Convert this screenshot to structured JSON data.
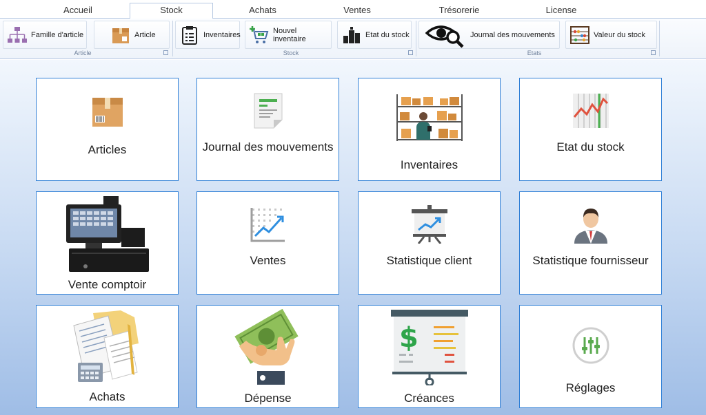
{
  "tabs": [
    {
      "label": "Accueil"
    },
    {
      "label": "Stock"
    },
    {
      "label": "Achats"
    },
    {
      "label": "Ventes"
    },
    {
      "label": "Trésorerie"
    },
    {
      "label": "License"
    }
  ],
  "active_tab": "Stock",
  "ribbon": {
    "buttons": [
      {
        "label": "Famille d'article",
        "icon": "hierarchy-icon"
      },
      {
        "label": "Article",
        "icon": "box-icon"
      },
      {
        "label": "Inventaires",
        "icon": "clipboard-icon"
      },
      {
        "label": "Nouvel inventaire",
        "icon": "cart-add-icon"
      },
      {
        "label": "Etat du stock",
        "icon": "stock-boxes-icon"
      },
      {
        "label": "Journal des mouvements",
        "icon": "eye-search-icon"
      },
      {
        "label": "Valeur du stock",
        "icon": "abacus-icon"
      }
    ],
    "groups": [
      "Article",
      "Stock",
      "Etats"
    ]
  },
  "tiles": [
    {
      "label": "Articles",
      "icon": "box-icon"
    },
    {
      "label": "Journal des mouvements",
      "icon": "document-icon"
    },
    {
      "label": "Inventaires",
      "icon": "warehouse-icon"
    },
    {
      "label": "Etat du stock",
      "icon": "line-chart-icon"
    },
    {
      "label": "Vente comptoir",
      "icon": "cash-register-icon"
    },
    {
      "label": "Ventes",
      "icon": "trend-chart-icon"
    },
    {
      "label": "Statistique client",
      "icon": "presentation-icon"
    },
    {
      "label": "Statistique fournisseur",
      "icon": "person-icon"
    },
    {
      "label": "Achats",
      "icon": "invoices-icon"
    },
    {
      "label": "Dépense",
      "icon": "money-hand-icon"
    },
    {
      "label": "Créances",
      "icon": "dollar-board-icon"
    },
    {
      "label": "Réglages",
      "icon": "settings-sliders-icon"
    }
  ]
}
